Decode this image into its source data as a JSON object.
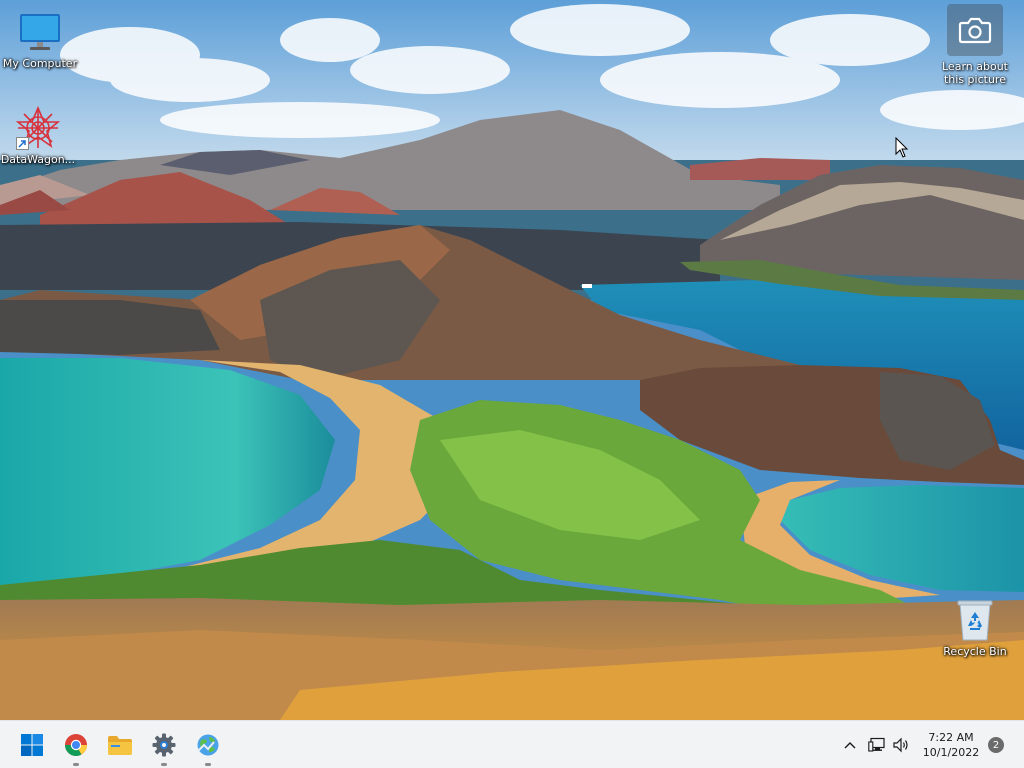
{
  "desktop": {
    "icons": [
      {
        "label": "My Computer",
        "icon": "monitor-icon"
      },
      {
        "label": "DataWagon...",
        "icon": "datawagon-logo-icon"
      },
      {
        "label": "Recycle Bin",
        "icon": "recycle-bin-icon"
      }
    ],
    "spotlight": {
      "label": "Learn about\nthis picture",
      "icon": "camera-icon"
    }
  },
  "taskbar": {
    "apps": [
      {
        "name": "Start",
        "icon": "windows-start-icon",
        "running": false
      },
      {
        "name": "Google Chrome",
        "icon": "chrome-icon",
        "running": true
      },
      {
        "name": "File Explorer",
        "icon": "folder-icon",
        "running": false
      },
      {
        "name": "Settings",
        "icon": "gear-icon",
        "running": true
      },
      {
        "name": "Network",
        "icon": "globe-icon",
        "running": true
      }
    ],
    "tray": {
      "icons": [
        "chevron-up-icon",
        "network-icon",
        "speaker-icon"
      ],
      "time": "7:22 AM",
      "date": "10/1/2022",
      "notification_count": "2"
    }
  },
  "colors": {
    "taskbar_bg": "#f1f3f5",
    "start_blue": "#0078d4",
    "folder_yellow": "#f5c542"
  }
}
